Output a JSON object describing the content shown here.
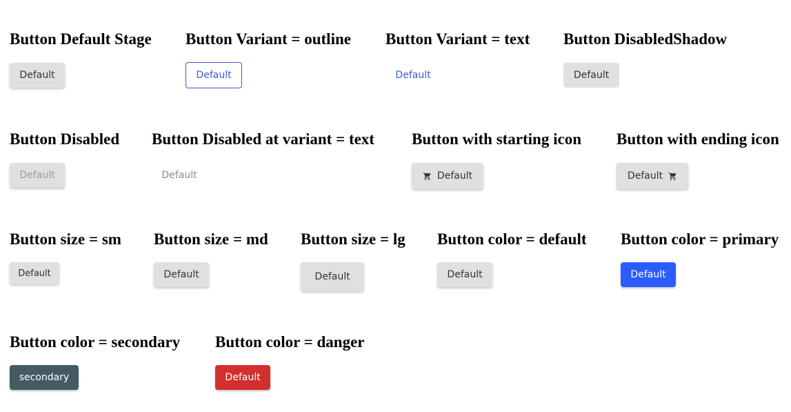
{
  "sections": [
    {
      "title": "Button Default Stage",
      "button": "Default"
    },
    {
      "title": "Button Variant = outline",
      "button": "Default"
    },
    {
      "title": "Button Variant = text",
      "button": "Default"
    },
    {
      "title": "Button DisabledShadow",
      "button": "Default"
    },
    {
      "title": "Button Disabled",
      "button": "Default"
    },
    {
      "title": "Button Disabled at variant = text",
      "button": "Default"
    },
    {
      "title": "Button with starting icon",
      "button": "Default",
      "icon": "cart-icon"
    },
    {
      "title": "Button with ending icon",
      "button": "Default",
      "icon": "cart-icon"
    },
    {
      "title": "Button size = sm",
      "button": "Default"
    },
    {
      "title": "Button size = md",
      "button": "Default"
    },
    {
      "title": "Button size = lg",
      "button": "Default"
    },
    {
      "title": "Button color = default",
      "button": "Default"
    },
    {
      "title": "Button color = primary",
      "button": "Default"
    },
    {
      "title": "Button color = secondary",
      "button": "secondary"
    },
    {
      "title": "Button color = danger",
      "button": "Default"
    }
  ],
  "colors": {
    "default_bg": "#e0e0e0",
    "outline_accent": "#3c57d6",
    "primary": "#2b5cff",
    "secondary": "#455a64",
    "danger": "#d32f2f"
  }
}
